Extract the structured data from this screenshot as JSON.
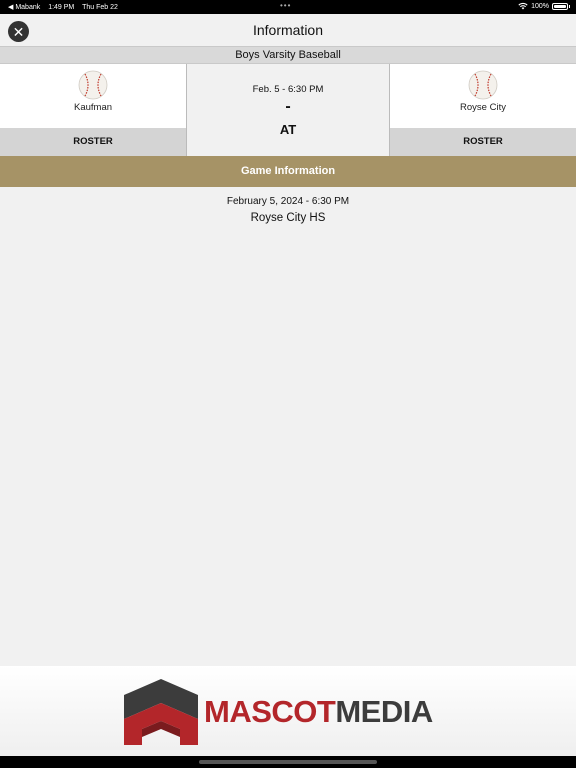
{
  "status_bar": {
    "back_app": "◀ Mabank",
    "time": "1:49 PM",
    "date": "Thu Feb 22",
    "dots": "•••",
    "battery": "100%"
  },
  "nav": {
    "close_glyph": "✕",
    "title": "Information"
  },
  "sport": "Boys Varsity Baseball",
  "game": {
    "away_team": "Kaufman",
    "home_team": "Royse City",
    "time_short": "Feb. 5 - 6:30 PM",
    "score": "-",
    "at_label": "AT",
    "roster_label": "ROSTER"
  },
  "section": {
    "header": "Game Information",
    "date_full": "February 5, 2024 - 6:30 PM",
    "location": "Royse City HS"
  },
  "ad": {
    "brand_part1": "MASCOT",
    "brand_part2": "MEDIA"
  },
  "icons": {
    "team_logo": "baseball-icon",
    "close": "close-icon"
  },
  "colors": {
    "section_header": "#a69366",
    "brand_red": "#b3262a",
    "brand_gray": "#3c3c3c"
  }
}
